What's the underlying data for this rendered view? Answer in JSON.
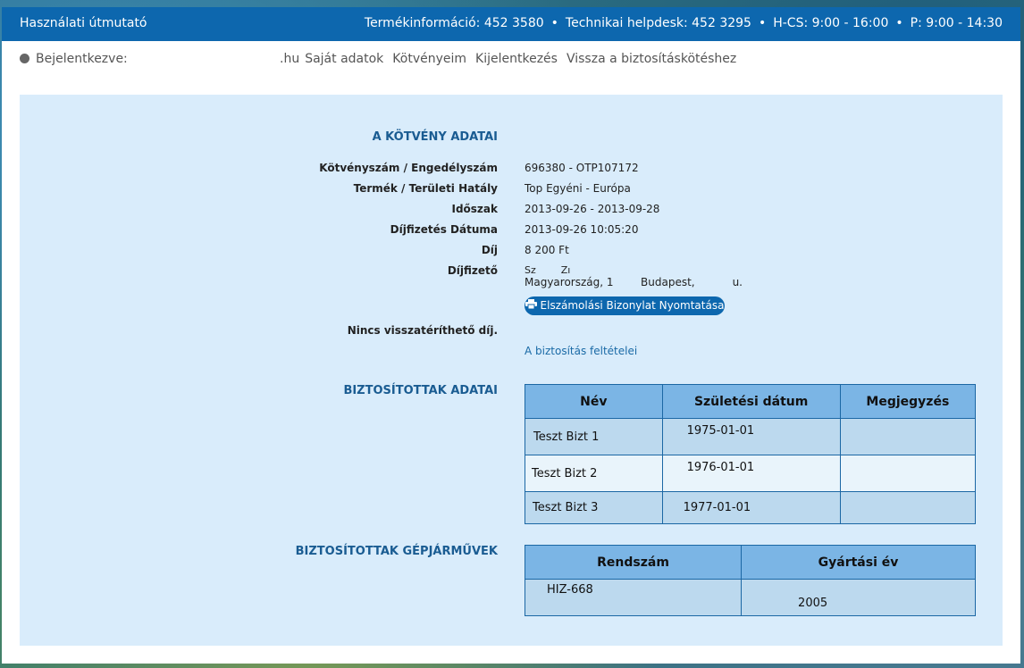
{
  "topbar": {
    "guide": "Használati útmutató",
    "product_info": "Termékinformáció: 452 3580",
    "helpdesk": "Technikai helpdesk: 452 3295",
    "hours_weekdays": "H-CS: 9:00 - 16:00",
    "hours_friday": "P: 9:00 - 14:30"
  },
  "subnav": {
    "logged_in": "Bejelentkezve:",
    "domain": ".hu",
    "links": [
      "Saját adatok",
      "Kötvényeim",
      "Kijelentkezés",
      "Vissza a biztosításkötéshez"
    ]
  },
  "policy": {
    "title": "A KÖTVÉNY ADATAI",
    "rows": [
      {
        "label": "Kötvényszám / Engedélyszám",
        "value": "696380 - OTP107172"
      },
      {
        "label": "Termék / Területi Hatály",
        "value": "Top Egyéni - Európa"
      },
      {
        "label": "Időszak",
        "value": "2013-09-26 - 2013-09-28"
      },
      {
        "label": "Díjfizetés Dátuma",
        "value": "2013-09-26 10:05:20"
      },
      {
        "label": "Díj",
        "value": "8 200 Ft"
      }
    ],
    "payer_label": "Díjfizető",
    "payer_line1": "Sz        Zı",
    "payer_line2": "Magyarország, 1        Budapest,           u.",
    "print_button": "Elszámolási Bizonylat Nyomtatása",
    "no_refund": "Nincs visszatéríthető díj.",
    "terms_link": "A biztosítás feltételei"
  },
  "insured": {
    "title": "BIZTOSÍTOTTAK ADATAI",
    "headers": [
      "Név",
      "Születési dátum",
      "Megjegyzés"
    ],
    "rows": [
      [
        "Teszt Bizt 1",
        "1975-01-01",
        ""
      ],
      [
        "Teszt Bizt 2",
        "1976-01-01",
        ""
      ],
      [
        "Teszt Bizt 3",
        "1977-01-01",
        ""
      ]
    ]
  },
  "vehicles": {
    "title": "BIZTOSÍTOTTAK GÉPJÁRMŰVEK",
    "headers": [
      "Rendszám",
      "Gyártási év"
    ],
    "rows": [
      [
        "HIZ-668",
        "2005"
      ]
    ]
  }
}
